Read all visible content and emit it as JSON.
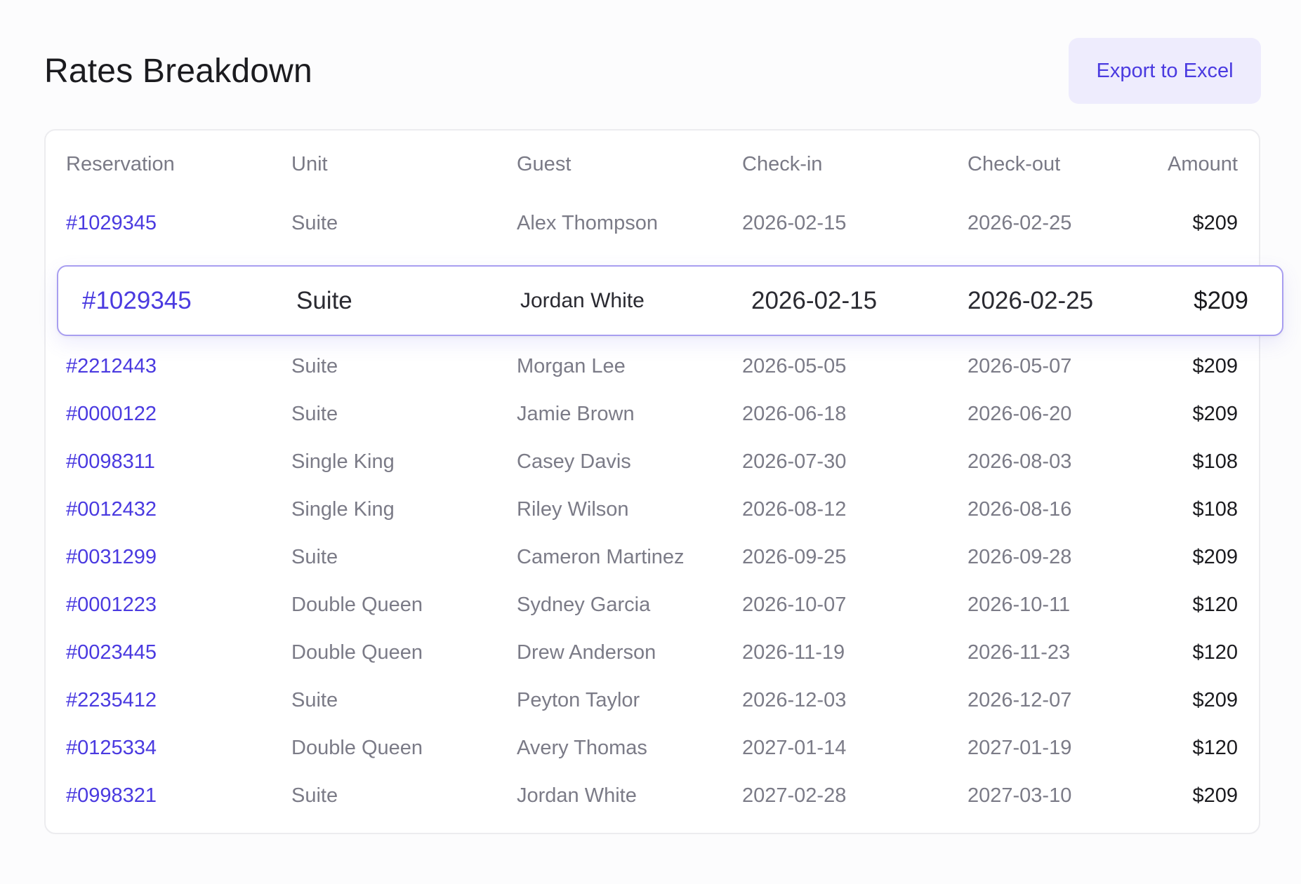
{
  "header": {
    "title": "Rates Breakdown",
    "export_label": "Export to Excel"
  },
  "table": {
    "columns": [
      "Reservation",
      "Unit",
      "Guest",
      "Check-in",
      "Check-out",
      "Amount"
    ],
    "rows": [
      {
        "reservation": "#1029345",
        "unit": "Suite",
        "guest": "Alex Thompson",
        "check_in": "2026-02-15",
        "check_out": "2026-02-25",
        "amount": "$209"
      },
      {
        "reservation": "#2212443",
        "unit": "Suite",
        "guest": "Morgan Lee",
        "check_in": "2026-05-05",
        "check_out": "2026-05-07",
        "amount": "$209"
      },
      {
        "reservation": "#0000122",
        "unit": "Suite",
        "guest": "Jamie Brown",
        "check_in": "2026-06-18",
        "check_out": "2026-06-20",
        "amount": "$209"
      },
      {
        "reservation": "#0098311",
        "unit": "Single King",
        "guest": "Casey Davis",
        "check_in": "2026-07-30",
        "check_out": "2026-08-03",
        "amount": "$108"
      },
      {
        "reservation": "#0012432",
        "unit": "Single King",
        "guest": "Riley Wilson",
        "check_in": "2026-08-12",
        "check_out": "2026-08-16",
        "amount": "$108"
      },
      {
        "reservation": "#0031299",
        "unit": "Suite",
        "guest": "Cameron Martinez",
        "check_in": "2026-09-25",
        "check_out": "2026-09-28",
        "amount": "$209"
      },
      {
        "reservation": "#0001223",
        "unit": "Double Queen",
        "guest": "Sydney Garcia",
        "check_in": "2026-10-07",
        "check_out": "2026-10-11",
        "amount": "$120"
      },
      {
        "reservation": "#0023445",
        "unit": "Double Queen",
        "guest": "Drew Anderson",
        "check_in": "2026-11-19",
        "check_out": "2026-11-23",
        "amount": "$120"
      },
      {
        "reservation": "#2235412",
        "unit": "Suite",
        "guest": "Peyton Taylor",
        "check_in": "2026-12-03",
        "check_out": "2026-12-07",
        "amount": "$209"
      },
      {
        "reservation": "#0125334",
        "unit": "Double Queen",
        "guest": "Avery Thomas",
        "check_in": "2027-01-14",
        "check_out": "2027-01-19",
        "amount": "$120"
      },
      {
        "reservation": "#0998321",
        "unit": "Suite",
        "guest": "Jordan White",
        "check_in": "2027-02-28",
        "check_out": "2027-03-10",
        "amount": "$209"
      }
    ],
    "highlighted_row": {
      "reservation": "#1029345",
      "unit": "Suite",
      "guest": "Jordan White",
      "check_in": "2026-02-15",
      "check_out": "2026-02-25",
      "amount": "$209"
    }
  },
  "colors": {
    "accent": "#4a3ae0",
    "button_bg": "#eeecfd",
    "highlight_border": "#a89ef0",
    "muted_text": "#7b7b87",
    "dark_text": "#1b1b1f"
  }
}
